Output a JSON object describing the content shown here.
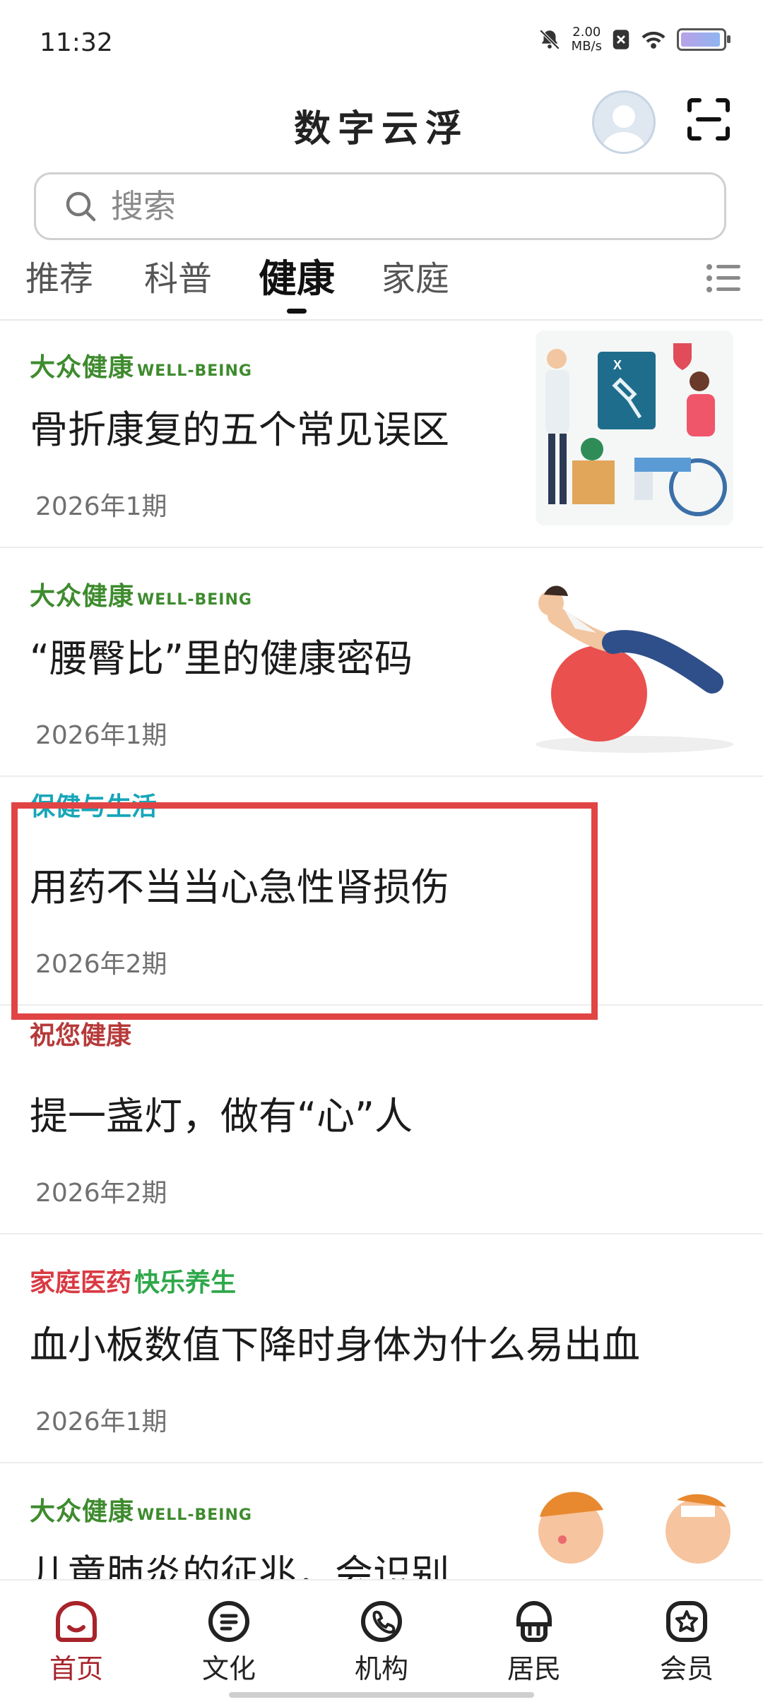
{
  "status": {
    "time": "11:32",
    "speed_value": "2.00",
    "speed_unit": "MB/s"
  },
  "header": {
    "title": "数字云浮"
  },
  "search": {
    "placeholder": "搜索"
  },
  "tabs": [
    {
      "label": "推荐"
    },
    {
      "label": "科普"
    },
    {
      "label": "健康"
    },
    {
      "label": "家庭"
    }
  ],
  "articles": [
    {
      "publication": "大众健康",
      "publication_sub": "WELL-BEING",
      "title": "骨折康复的五个常见误区",
      "issue": "2026年1期"
    },
    {
      "publication": "大众健康",
      "publication_sub": "WELL-BEING",
      "title": "“腰臀比”里的健康密码",
      "issue": "2026年1期"
    },
    {
      "publication": "保健与生活",
      "title": "用药不当当心急性肾损伤",
      "issue": "2026年2期"
    },
    {
      "publication": "祝您健康",
      "title": "提一盏灯，做有“心”人",
      "issue": "2026年2期"
    },
    {
      "publication": "家庭医药",
      "publication_sub": "快乐养生",
      "title": "血小板数值下降时身体为什么易出血",
      "issue": "2026年1期"
    },
    {
      "publication": "大众健康",
      "publication_sub": "WELL-BEING",
      "title": "儿童肺炎的征兆，会识别",
      "issue": ""
    }
  ],
  "bottom_nav": [
    {
      "label": "首页"
    },
    {
      "label": "文化"
    },
    {
      "label": "机构"
    },
    {
      "label": "居民"
    },
    {
      "label": "会员"
    }
  ],
  "colors": {
    "accent": "#a8232a",
    "highlight_box": "#e14444",
    "brand_green": "#3e8b2e"
  }
}
